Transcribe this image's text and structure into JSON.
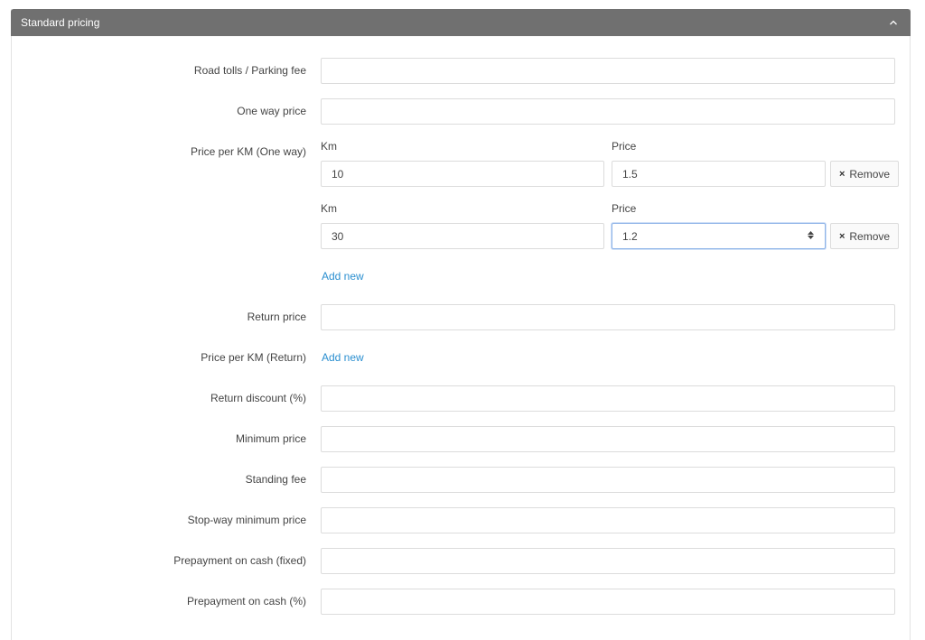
{
  "panel": {
    "title": "Standard pricing",
    "collapse_icon": "chevron-up-icon"
  },
  "fields": {
    "road_tolls": {
      "label": "Road tolls / Parking fee",
      "value": ""
    },
    "one_way_price": {
      "label": "One way price",
      "value": ""
    },
    "price_per_km_one_way": {
      "label": "Price per KM (One way)",
      "km_label": "Km",
      "price_label": "Price",
      "rows": [
        {
          "km": "10",
          "price": "1.5",
          "remove_label": "Remove"
        },
        {
          "km": "30",
          "price": "1.2",
          "remove_label": "Remove"
        }
      ],
      "add_new": "Add new"
    },
    "return_price": {
      "label": "Return price",
      "value": ""
    },
    "price_per_km_return": {
      "label": "Price per KM (Return)",
      "add_new": "Add new"
    },
    "return_discount": {
      "label": "Return discount (%)",
      "value": ""
    },
    "minimum_price": {
      "label": "Minimum price",
      "value": ""
    },
    "standing_fee": {
      "label": "Standing fee",
      "value": ""
    },
    "stop_way_minimum_price": {
      "label": "Stop-way minimum price",
      "value": ""
    },
    "prepayment_fixed": {
      "label": "Prepayment on cash (fixed)",
      "value": ""
    },
    "prepayment_percent": {
      "label": "Prepayment on cash (%)",
      "value": ""
    }
  },
  "colors": {
    "header_bg": "#707070",
    "link": "#2b8fd0",
    "focus_border": "#8fb4e8"
  }
}
